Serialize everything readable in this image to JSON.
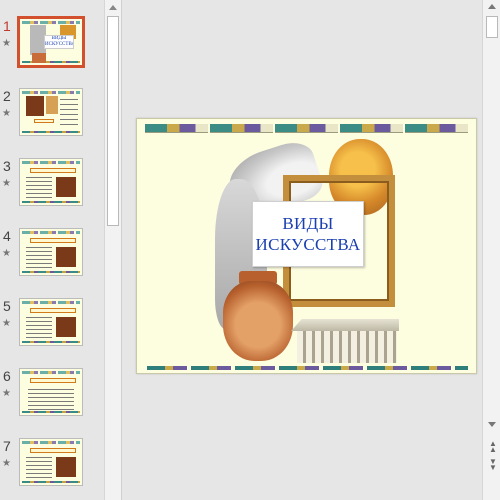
{
  "slides": [
    {
      "number": "1",
      "active": true,
      "star": "★",
      "kind": "title",
      "label": "ВИДЫ ИСКУССТВА"
    },
    {
      "number": "2",
      "active": false,
      "star": "★",
      "kind": "picture-left"
    },
    {
      "number": "3",
      "active": false,
      "star": "★",
      "kind": "text-right"
    },
    {
      "number": "4",
      "active": false,
      "star": "★",
      "kind": "text-right"
    },
    {
      "number": "5",
      "active": false,
      "star": "★",
      "kind": "text-right"
    },
    {
      "number": "6",
      "active": false,
      "star": "★",
      "kind": "text-only"
    },
    {
      "number": "7",
      "active": false,
      "star": "★",
      "kind": "text-right"
    }
  ],
  "main_slide": {
    "title_line1": "ВИДЫ",
    "title_line2": "ИСКУССТВА"
  },
  "colors": {
    "slide_bg": "#fdfde0",
    "title_text": "#1a3fb0",
    "active_accent": "#d2502d"
  },
  "icons": {
    "slide_flag": "star-icon",
    "scroll_up": "arrow-up-icon",
    "scroll_down": "arrow-down-icon",
    "prev_slide": "double-up-icon",
    "next_slide": "double-down-icon"
  }
}
